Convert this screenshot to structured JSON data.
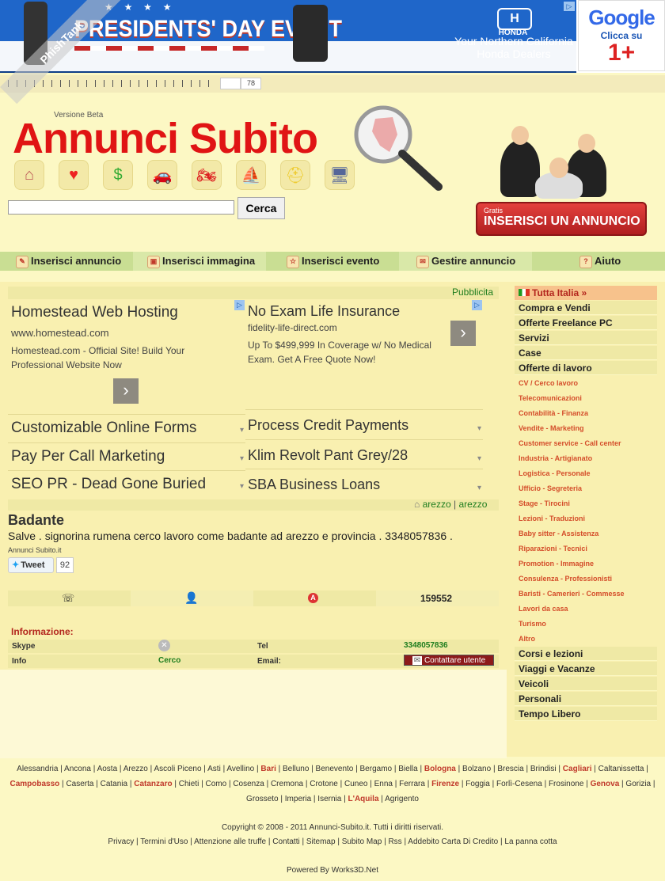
{
  "banner": {
    "honda_ad_title": "PRESIDENTS' DAY EVENT",
    "honda_brand": "HONDA",
    "honda_stars": "★ ★ ★ ★",
    "honda_tagline_1": "Your Northern California",
    "honda_tagline_2": "Honda Dealers",
    "google_logo": "Google",
    "google_text": "Clicca su",
    "google_plus": "1+",
    "ad_choice": "▷"
  },
  "rating": {
    "count": "78"
  },
  "header": {
    "version": "Versione Beta",
    "logo": "Annunci Subito",
    "search_placeholder": "",
    "search_button": "Cerca",
    "insert_gratis": "Gratis",
    "insert_button": "INSERISCI UN ANNUNCIO"
  },
  "category_icons": [
    "house-icon",
    "heart-icon",
    "money-icon",
    "car-icon",
    "motorbike-icon",
    "boat-icon",
    "helmet-icon",
    "computer-icon"
  ],
  "nav": [
    {
      "label": "Inserisci annuncio",
      "icon": "pencil-icon"
    },
    {
      "label": "Inserisci immagina",
      "icon": "image-icon"
    },
    {
      "label": "Inserisci evento",
      "icon": "star-icon"
    },
    {
      "label": "Gestire annuncio",
      "icon": "mail-icon"
    },
    {
      "label": "Aiuto",
      "icon": "help-icon"
    }
  ],
  "ads": {
    "label": "Pubblicita",
    "ad1": {
      "title": "Homestead Web Hosting",
      "url": "www.homestead.com",
      "desc": "Homestead.com - Official Site! Build Your Professional Website Now"
    },
    "ad2": {
      "title": "No Exam Life Insurance",
      "url": "fidelity-life-direct.com",
      "desc": "Up To $499,999 In Coverage w/ No Medical Exam. Get A Free Quote Now!"
    },
    "arrow": "›",
    "links_left": [
      "Customizable Online Forms",
      "Pay Per Call Marketing",
      "SEO PR - Dead Gone Buried"
    ],
    "links_right": [
      "Process Credit Payments",
      "Klim Revolt Pant Grey/28",
      "SBA Business Loans"
    ],
    "dropdown": "▾"
  },
  "location": {
    "city1": "arezzo",
    "separator": "|",
    "city2": "arezzo"
  },
  "listing": {
    "title": "Badante",
    "description": "Salve . signorina rumena cerco lavoro come badante ad arezzo e provincia . 3348057836 .",
    "source": "Annunci Subito.it",
    "tweet_label": "Tweet",
    "tweet_count": "92",
    "views": "159552"
  },
  "info": {
    "title": "Informazione:",
    "skype_label": "Skype",
    "tel_label": "Tel",
    "tel_value": "3348057836",
    "info_label": "Info",
    "info_value": "Cerco",
    "email_label": "Email:",
    "contact_button": "Contattare utente"
  },
  "sidebar": {
    "top": "Tutta Italia »",
    "items_1": [
      "Compra e Vendi",
      "Offerte Freelance PC",
      "Servizi",
      "Case",
      "Offerte di lavoro"
    ],
    "subitems": [
      "CV / Cerco lavoro",
      "Telecomunicazioni",
      "Contabilità - Finanza",
      "Vendite - Marketing",
      "Customer service - Call center",
      "Industria - Artigianato",
      "Logistica - Personale",
      "Ufficio - Segreteria",
      "Stage - Tirocini",
      "Lezioni - Traduzioni",
      "Baby sitter - Assistenza",
      "Riparazioni - Tecnici",
      "Promotion - Immagine",
      "Consulenza - Professionisti",
      "Baristi - Camerieri - Commesse",
      "Lavori da casa",
      "Turismo",
      "Altro"
    ],
    "items_2": [
      "Corsi e lezioni",
      "Viaggi e Vacanze",
      "Veicoli",
      "Personali",
      "Tempo Libero"
    ]
  },
  "footer": {
    "cities": [
      {
        "name": "Alessandria",
        "hl": false
      },
      {
        "name": "Ancona",
        "hl": false
      },
      {
        "name": "Aosta",
        "hl": false
      },
      {
        "name": "Arezzo",
        "hl": false
      },
      {
        "name": "Ascoli Piceno",
        "hl": false
      },
      {
        "name": "Asti",
        "hl": false
      },
      {
        "name": "Avellino",
        "hl": false
      },
      {
        "name": "Bari",
        "hl": true
      },
      {
        "name": "Belluno",
        "hl": false
      },
      {
        "name": "Benevento",
        "hl": false
      },
      {
        "name": "Bergamo",
        "hl": false
      },
      {
        "name": "Biella",
        "hl": false
      },
      {
        "name": "Bologna",
        "hl": true
      },
      {
        "name": "Bolzano",
        "hl": false
      },
      {
        "name": "Brescia",
        "hl": false
      },
      {
        "name": "Brindisi",
        "hl": false
      },
      {
        "name": "Cagliari",
        "hl": true
      },
      {
        "name": "Caltanissetta",
        "hl": false
      },
      {
        "name": "Campobasso",
        "hl": true
      },
      {
        "name": "Caserta",
        "hl": false
      },
      {
        "name": "Catania",
        "hl": false
      },
      {
        "name": "Catanzaro",
        "hl": true
      },
      {
        "name": "Chieti",
        "hl": false
      },
      {
        "name": "Como",
        "hl": false
      },
      {
        "name": "Cosenza",
        "hl": false
      },
      {
        "name": "Cremona",
        "hl": false
      },
      {
        "name": "Crotone",
        "hl": false
      },
      {
        "name": "Cuneo",
        "hl": false
      },
      {
        "name": "Enna",
        "hl": false
      },
      {
        "name": "Ferrara",
        "hl": false
      },
      {
        "name": "Firenze",
        "hl": true
      },
      {
        "name": "Foggia",
        "hl": false
      },
      {
        "name": "Forlì-Cesena",
        "hl": false
      },
      {
        "name": "Frosinone",
        "hl": false
      },
      {
        "name": "Genova",
        "hl": true
      },
      {
        "name": "Gorizia",
        "hl": false
      },
      {
        "name": "Grosseto",
        "hl": false
      },
      {
        "name": "Imperia",
        "hl": false
      },
      {
        "name": "Isernia",
        "hl": false
      },
      {
        "name": "L'Aquila",
        "hl": true
      },
      {
        "name": "Agrigento",
        "hl": false
      }
    ],
    "copyright": "Copyright © 2008 - 2011 Annunci-Subito.it. Tutti i diritti riservati.",
    "links": [
      "Privacy",
      "Termini d'Uso",
      "Attenzione alle truffe",
      "Contatti",
      "Sitemap",
      "Subito Map",
      "Rss",
      "Addebito Carta Di Credito",
      "La panna cotta"
    ],
    "powered": "Powered By Works3D.Net"
  },
  "watermark": "PhishTank",
  "colors": {
    "accent_red": "#e01414",
    "link_green": "#1e7d1e",
    "nav_green": "#c9de93",
    "page_bg": "#fcf8c4"
  }
}
